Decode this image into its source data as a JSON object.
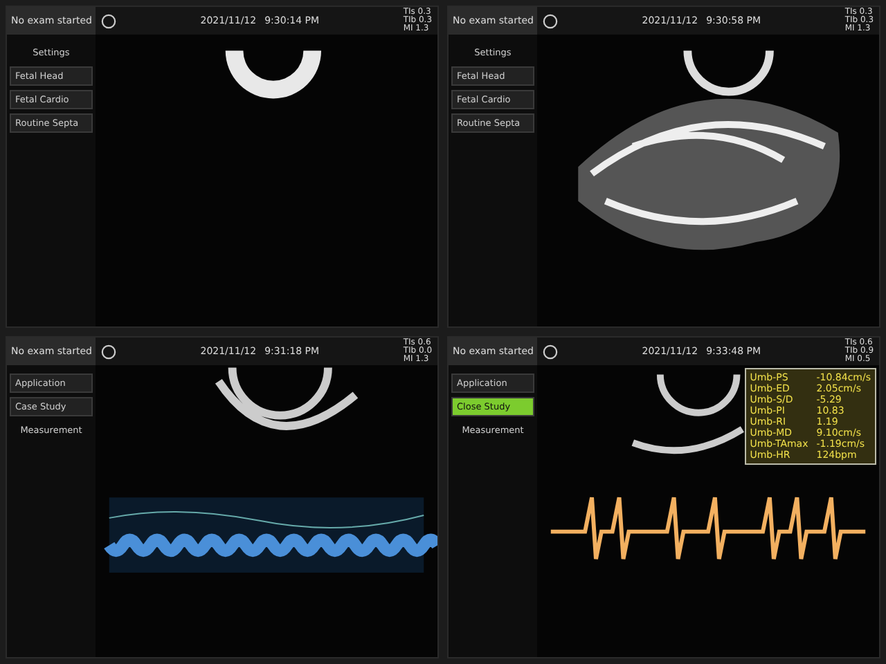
{
  "screens": [
    {
      "status": "No exam started",
      "date": "2021/11/12",
      "time": "9:30:14 PM",
      "kind": "bmode",
      "indices": [
        {
          "label": "TIs",
          "value": "0.3"
        },
        {
          "label": "TIb",
          "value": "0.3"
        },
        {
          "label": "MI",
          "value": "1.3"
        }
      ],
      "menu": [
        {
          "kind": "heading",
          "label": "Settings",
          "selected": false
        },
        {
          "kind": "row",
          "label": "Fetal Head",
          "selected": false
        },
        {
          "kind": "row",
          "label": "Fetal Cardio",
          "selected": false
        },
        {
          "kind": "row",
          "label": "Routine Septa",
          "selected": false
        }
      ]
    },
    {
      "status": "No exam started",
      "date": "2021/11/12",
      "time": "9:30:58 PM",
      "kind": "blob",
      "indices": [
        {
          "label": "TIs",
          "value": "0.3"
        },
        {
          "label": "TIb",
          "value": "0.3"
        },
        {
          "label": "MI",
          "value": "1.3"
        }
      ],
      "menu": [
        {
          "kind": "heading",
          "label": "Settings",
          "selected": false
        },
        {
          "kind": "row",
          "label": "Fetal Head",
          "selected": false
        },
        {
          "kind": "row",
          "label": "Fetal Cardio",
          "selected": false
        },
        {
          "kind": "row",
          "label": "Routine Septa",
          "selected": false
        }
      ]
    },
    {
      "status": "No exam started",
      "date": "2021/11/12",
      "time": "9:31:18 PM",
      "kind": "mmode",
      "indices": [
        {
          "label": "TIs",
          "value": "0.6"
        },
        {
          "label": "TIb",
          "value": "0.0"
        },
        {
          "label": "MI",
          "value": "1.3"
        }
      ],
      "menu": [
        {
          "kind": "row",
          "label": "Application",
          "selected": false
        },
        {
          "kind": "row",
          "label": "Case Study",
          "selected": false
        },
        {
          "kind": "heading",
          "label": "Measurement",
          "selected": false
        }
      ]
    },
    {
      "status": "No exam started",
      "date": "2021/11/12",
      "time": "9:33:48 PM",
      "kind": "doppler",
      "indices": [
        {
          "label": "TIs",
          "value": "0.6"
        },
        {
          "label": "TIb",
          "value": "0.9"
        },
        {
          "label": "MI",
          "value": "0.5"
        }
      ],
      "menu": [
        {
          "kind": "row",
          "label": "Application",
          "selected": false
        },
        {
          "kind": "row",
          "label": "Close Study",
          "selected": true
        },
        {
          "kind": "heading",
          "label": "Measurement",
          "selected": false
        }
      ],
      "measurements": [
        {
          "name": "Umb-PS",
          "value": "-10.84cm/s"
        },
        {
          "name": "Umb-ED",
          "value": "2.05cm/s"
        },
        {
          "name": "Umb-S/D",
          "value": "-5.29"
        },
        {
          "name": "Umb-PI",
          "value": "10.83"
        },
        {
          "name": "Umb-RI",
          "value": "1.19"
        },
        {
          "name": "Umb-MD",
          "value": "9.10cm/s"
        },
        {
          "name": "Umb-TAmax",
          "value": "-1.19cm/s"
        },
        {
          "name": "Umb-HR",
          "value": "124bpm"
        }
      ]
    }
  ]
}
